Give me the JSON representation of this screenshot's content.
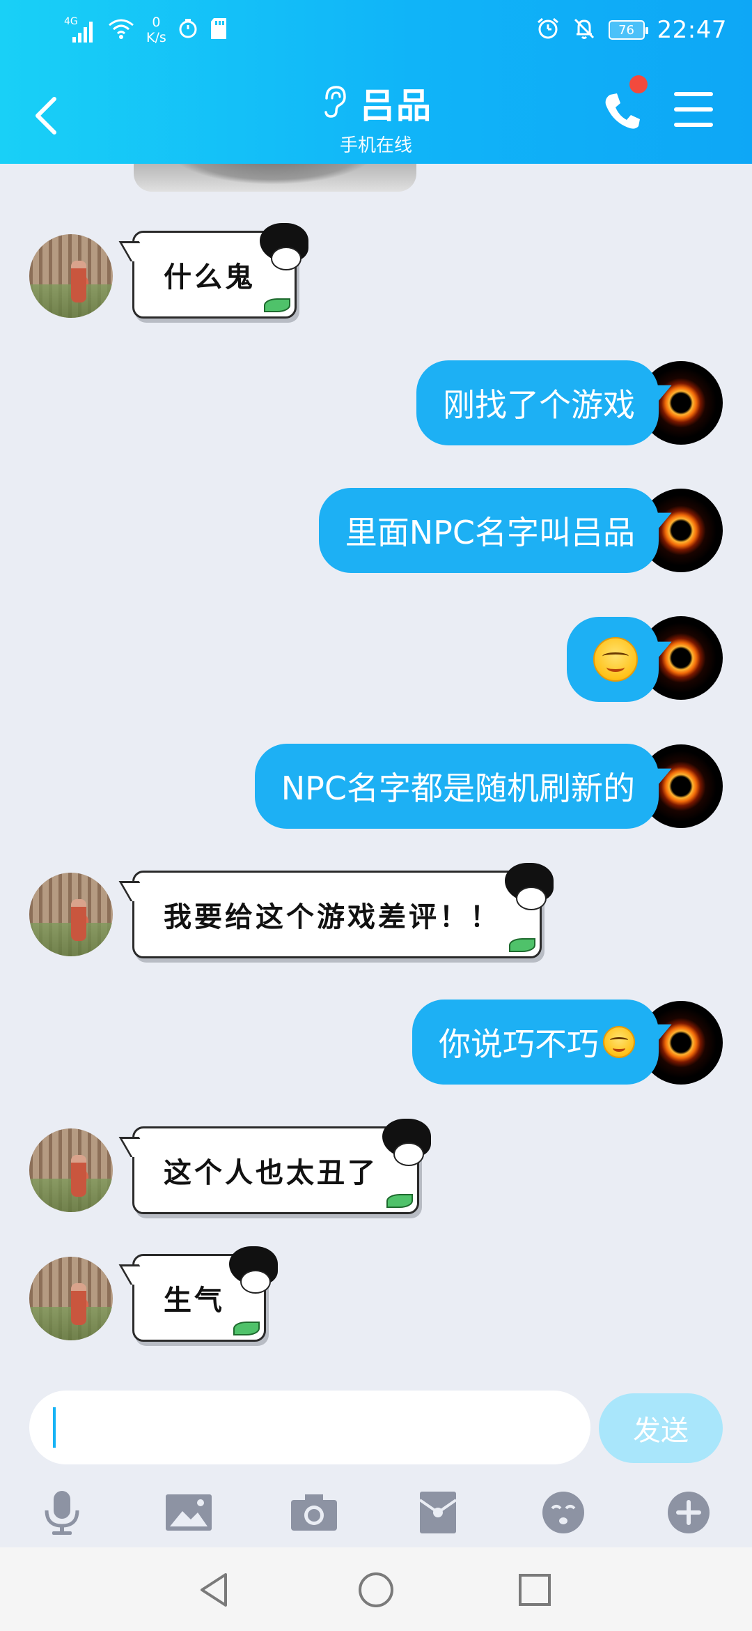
{
  "status_bar": {
    "network": "4G",
    "speed_value": "0",
    "speed_unit": "K/s",
    "battery": "76",
    "time": "22:47"
  },
  "header": {
    "title": "吕品",
    "subtitle": "手机在线",
    "icons": [
      "back-arrow-icon",
      "ear-icon",
      "phone-icon",
      "menu-icon"
    ],
    "accent_color": "#10b4f8",
    "notification_dot_color": "#f24a3d"
  },
  "messages": [
    {
      "side": "in",
      "text": "什么鬼"
    },
    {
      "side": "out",
      "text": "刚找了个游戏"
    },
    {
      "side": "out",
      "text": "里面NPC名字叫吕品"
    },
    {
      "side": "out",
      "emoji": "smirk-emoji"
    },
    {
      "side": "out",
      "text": "NPC名字都是随机刷新的"
    },
    {
      "side": "in",
      "text": "我要给这个游戏差评！！"
    },
    {
      "side": "out",
      "text": "你说巧不巧",
      "emoji": "smirk-emoji"
    },
    {
      "side": "in",
      "text": "这个人也太丑了"
    },
    {
      "side": "in",
      "text": "生气"
    }
  ],
  "composer": {
    "input_value": "",
    "send_label": "发送",
    "tools": [
      "microphone-icon",
      "image-icon",
      "camera-icon",
      "red-packet-icon",
      "emoji-icon",
      "plus-icon"
    ]
  },
  "system_nav": [
    "back-triangle-icon",
    "home-circle-icon",
    "recents-square-icon"
  ]
}
